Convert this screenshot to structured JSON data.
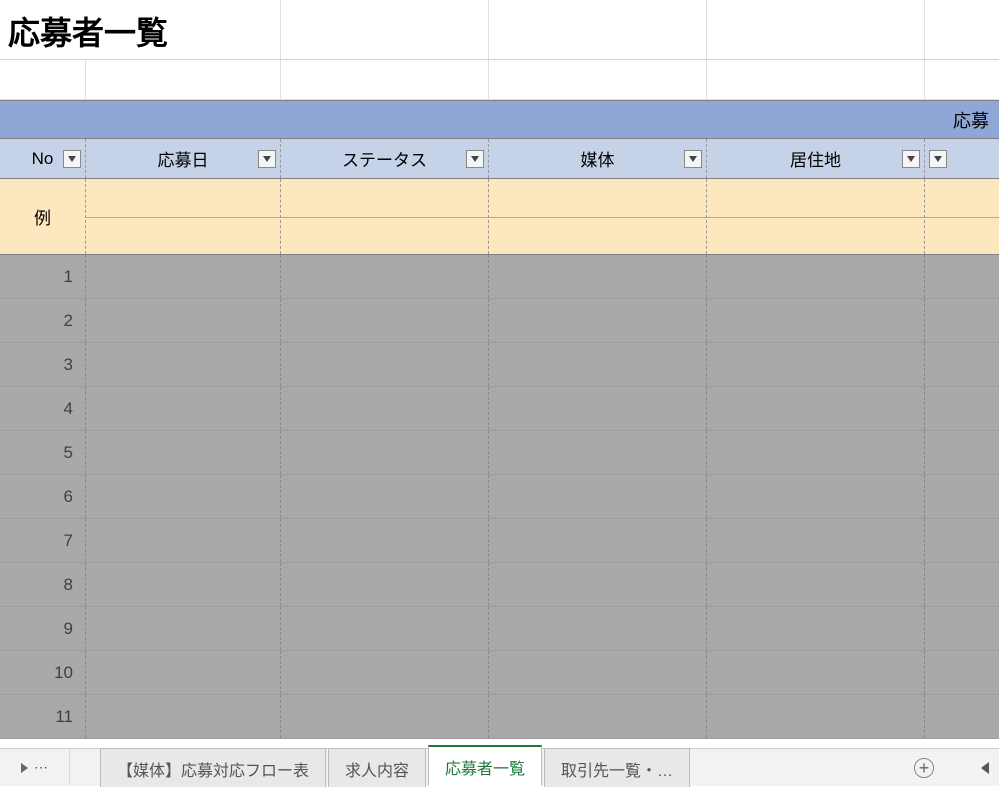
{
  "title": "応募者一覧",
  "band_label_partial": "応募",
  "columns": [
    {
      "label": "No"
    },
    {
      "label": "応募日"
    },
    {
      "label": "ステータス"
    },
    {
      "label": "媒体"
    },
    {
      "label": "居住地"
    }
  ],
  "example_label": "例",
  "rows": [
    "1",
    "2",
    "3",
    "4",
    "5",
    "6",
    "7",
    "8",
    "9",
    "10",
    "11"
  ],
  "tabs": [
    {
      "label": "【媒体】応募対応フロー表",
      "active": false
    },
    {
      "label": "求人内容",
      "active": false
    },
    {
      "label": "応募者一覧",
      "active": true
    },
    {
      "label": "取引先一覧・…",
      "active": false
    }
  ]
}
